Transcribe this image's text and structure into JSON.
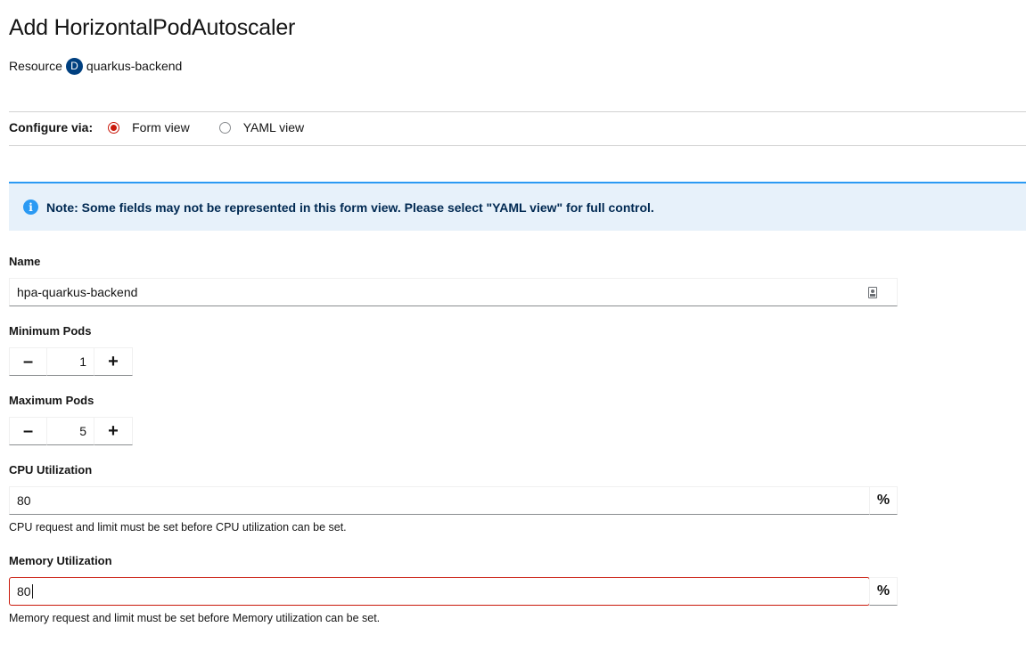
{
  "page": {
    "title": "Add HorizontalPodAutoscaler",
    "resource_label": "Resource",
    "resource_badge": "D",
    "resource_name": "quarkus-backend"
  },
  "configure": {
    "label": "Configure via:",
    "options": [
      {
        "label": "Form view",
        "selected": true
      },
      {
        "label": "YAML view",
        "selected": false
      }
    ]
  },
  "alert": {
    "icon": "info-icon",
    "text": "Note: Some fields may not be represented in this form view. Please select \"YAML view\" for full control."
  },
  "form": {
    "name": {
      "label": "Name",
      "value": "hpa-quarkus-backend"
    },
    "min_pods": {
      "label": "Minimum Pods",
      "value": "1",
      "minus": "–",
      "plus": "+"
    },
    "max_pods": {
      "label": "Maximum Pods",
      "value": "5",
      "minus": "–",
      "plus": "+"
    },
    "cpu": {
      "label": "CPU Utilization",
      "value": "80",
      "unit": "%",
      "helper": "CPU request and limit must be set before CPU utilization can be set."
    },
    "memory": {
      "label": "Memory Utilization",
      "value": "80",
      "unit": "%",
      "helper": "Memory request and limit must be set before Memory utilization can be set."
    }
  },
  "colors": {
    "accent_radio": "#c9190b",
    "alert_bg": "#e7f1fa",
    "alert_border": "#2b9af3",
    "badge_bg": "#004080",
    "error_border": "#c9190b"
  }
}
